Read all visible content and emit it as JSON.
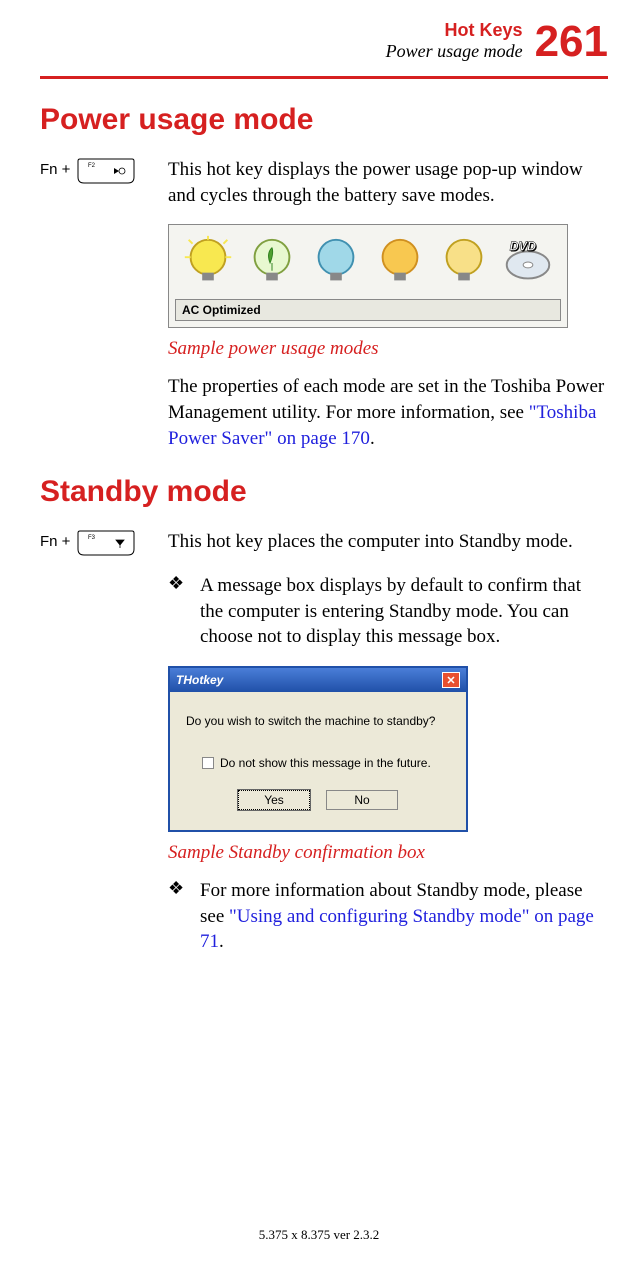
{
  "header": {
    "title": "Hot Keys",
    "subtitle": "Power usage mode",
    "page_num": "261"
  },
  "section1": {
    "title": "Power usage mode",
    "fn": "Fn +",
    "intro": "This hot key displays the power usage pop-up window and cycles through the battery save modes.",
    "ac_label": "AC Optimized",
    "caption": "Sample power usage modes",
    "para_a": "The properties of each mode are set in the Toshiba Power Management utility. For more information, see ",
    "link": "\"Toshiba Power Saver\" on page 170",
    "para_b": "."
  },
  "section2": {
    "title": "Standby mode",
    "fn": "Fn +",
    "intro": "This hot key places the computer into Standby mode.",
    "bullet1": "A message box displays by default to confirm that the computer is entering Standby mode. You can choose not to display this message box.",
    "dialog": {
      "title": "THotkey",
      "message": "Do you wish to switch the machine to standby?",
      "checkbox": "Do not show this message in the future.",
      "yes": "Yes",
      "no": "No"
    },
    "caption": "Sample Standby confirmation box",
    "bullet2_a": "For more information about Standby mode, please see ",
    "bullet2_link": "\"Using and configuring Standby mode\" on page 71",
    "bullet2_b": "."
  },
  "footer": "5.375 x 8.375 ver 2.3.2"
}
